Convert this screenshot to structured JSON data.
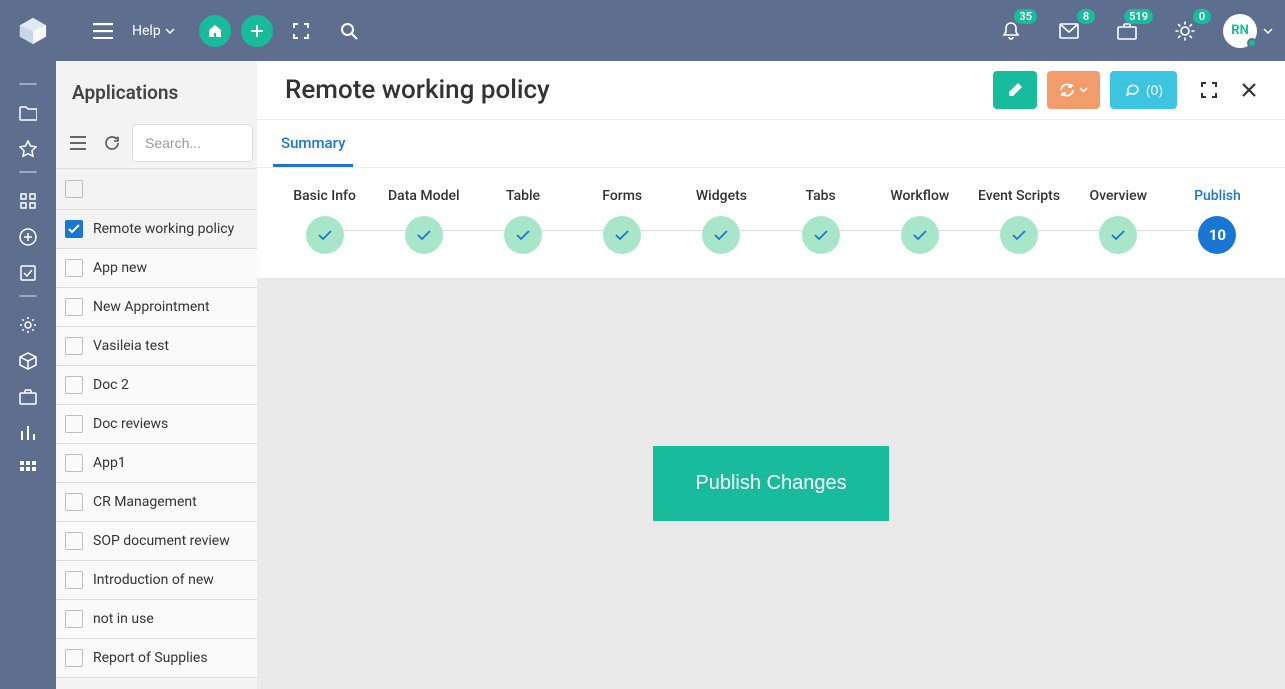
{
  "header": {
    "help_label": "Help",
    "notifications": {
      "bell": "35",
      "mail": "8",
      "briefcase": "519",
      "star": "0"
    },
    "avatar_initials": "RN"
  },
  "sidebar": {
    "title": "Applications",
    "search_placeholder": "Search..."
  },
  "apps": [
    {
      "name": "Remote working policy",
      "selected": true
    },
    {
      "name": "App new",
      "selected": false
    },
    {
      "name": "New Approintment",
      "selected": false
    },
    {
      "name": "Vasileia test",
      "selected": false
    },
    {
      "name": "Doc 2",
      "selected": false
    },
    {
      "name": "Doc reviews",
      "selected": false
    },
    {
      "name": "App1",
      "selected": false
    },
    {
      "name": "CR Management",
      "selected": false
    },
    {
      "name": "SOP document review",
      "selected": false
    },
    {
      "name": "Introduction of new",
      "selected": false
    },
    {
      "name": "not in use",
      "selected": false
    },
    {
      "name": "Report of Supplies",
      "selected": false
    }
  ],
  "content": {
    "title": "Remote working policy",
    "comments_label": "(0)",
    "tab_label": "Summary",
    "publish_button": "Publish Changes",
    "steps": [
      {
        "label": "Basic Info",
        "done": true
      },
      {
        "label": "Data Model",
        "done": true
      },
      {
        "label": "Table",
        "done": true
      },
      {
        "label": "Forms",
        "done": true
      },
      {
        "label": "Widgets",
        "done": true
      },
      {
        "label": "Tabs",
        "done": true
      },
      {
        "label": "Workflow",
        "done": true
      },
      {
        "label": "Event Scripts",
        "done": true
      },
      {
        "label": "Overview",
        "done": true
      },
      {
        "label": "Publish",
        "done": false,
        "value": "10"
      }
    ]
  }
}
